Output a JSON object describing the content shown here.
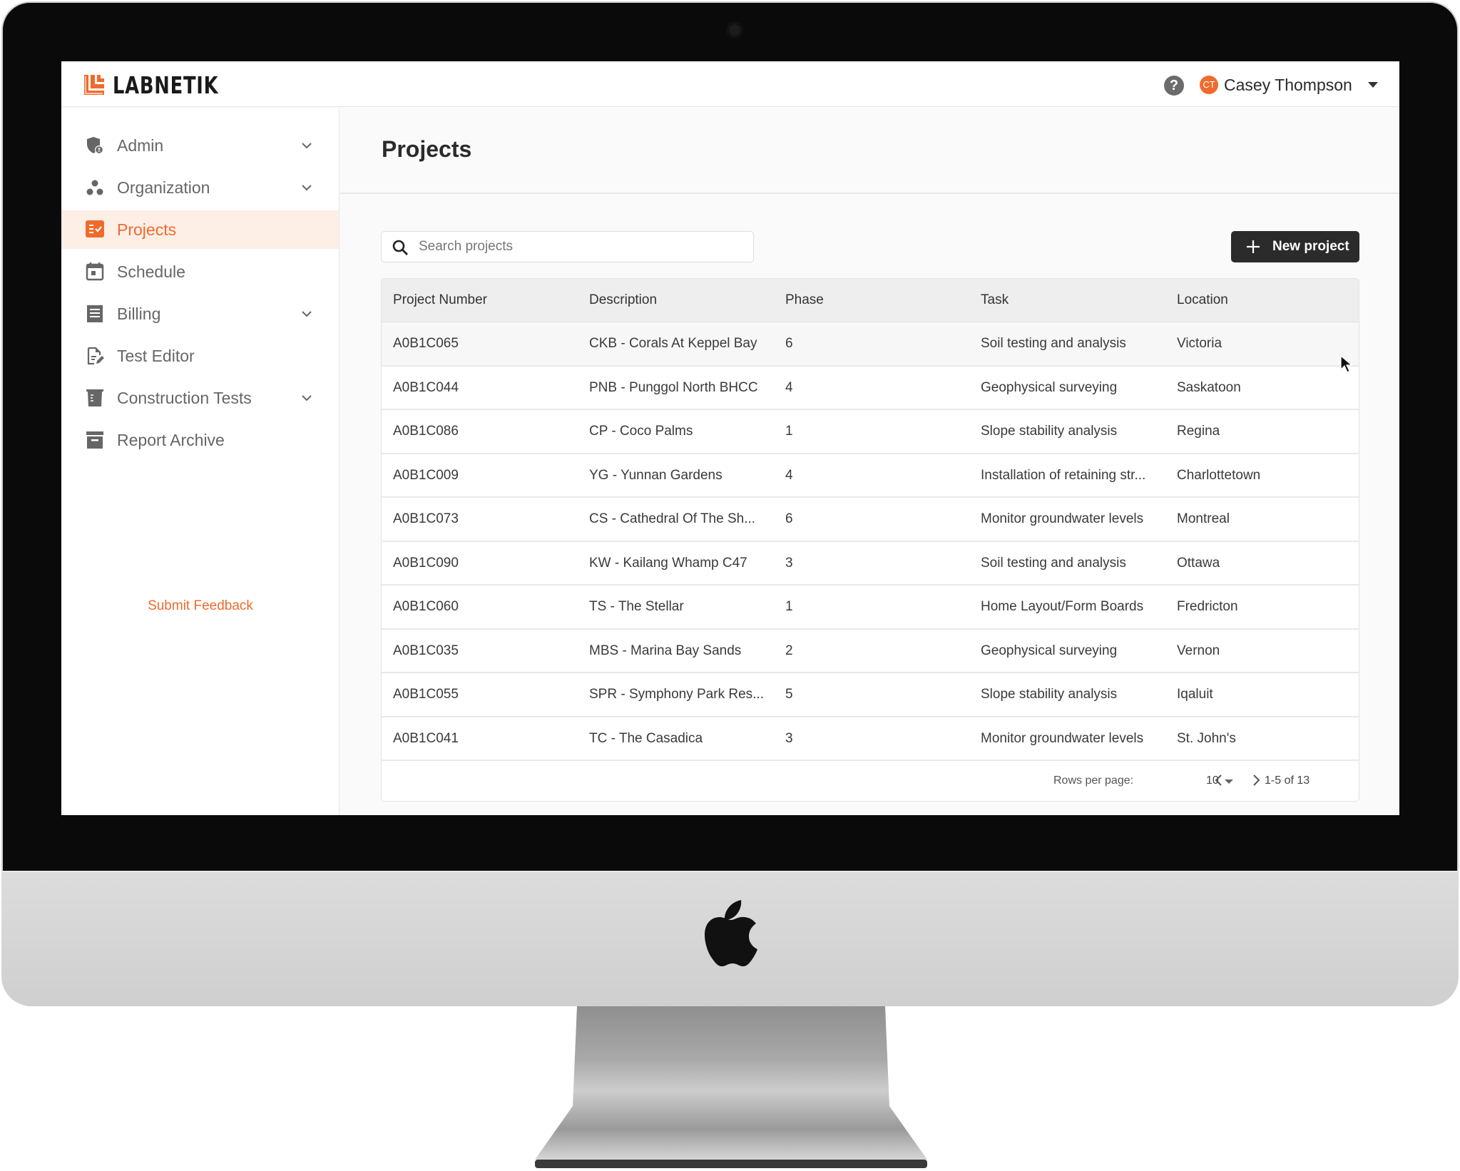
{
  "app": {
    "brand": "LABNETIK",
    "colors": {
      "accent": "#ef6b2d",
      "button_dark": "#2b2b2b",
      "active_bg": "#fdeee6"
    }
  },
  "header": {
    "help_icon": "question-circle-icon",
    "user": {
      "initials": "CT",
      "name": "Casey Thompson"
    }
  },
  "sidebar": {
    "items": [
      {
        "label": "Admin",
        "icon": "shield-user-icon",
        "expandable": true,
        "active": false
      },
      {
        "label": "Organization",
        "icon": "group-dots-icon",
        "expandable": true,
        "active": false
      },
      {
        "label": "Projects",
        "icon": "checklist-icon",
        "expandable": false,
        "active": true
      },
      {
        "label": "Schedule",
        "icon": "calendar-icon",
        "expandable": false,
        "active": false
      },
      {
        "label": "Billing",
        "icon": "receipt-icon",
        "expandable": true,
        "active": false
      },
      {
        "label": "Test Editor",
        "icon": "document-edit-icon",
        "expandable": false,
        "active": false
      },
      {
        "label": "Construction Tests",
        "icon": "beaker-icon",
        "expandable": true,
        "active": false
      },
      {
        "label": "Report Archive",
        "icon": "archive-box-icon",
        "expandable": false,
        "active": false
      }
    ],
    "feedback_label": "Submit Feedback"
  },
  "main": {
    "title": "Projects",
    "search": {
      "placeholder": "Search projects",
      "value": ""
    },
    "new_button_label": "New project",
    "table": {
      "columns": [
        "Project Number",
        "Description",
        "Phase",
        "Task",
        "Location"
      ],
      "rows": [
        [
          "A0B1C065",
          "CKB - Corals At Keppel Bay",
          "6",
          "Soil testing and analysis",
          "Victoria"
        ],
        [
          "A0B1C044",
          "PNB - Punggol North BHCC",
          "4",
          "Geophysical surveying",
          "Saskatoon"
        ],
        [
          "A0B1C086",
          "CP - Coco Palms",
          "1",
          "Slope stability analysis",
          "Regina"
        ],
        [
          "A0B1C009",
          "YG - Yunnan Gardens",
          "4",
          "Installation of retaining str...",
          "Charlottetown"
        ],
        [
          "A0B1C073",
          "CS - Cathedral Of The Sh...",
          "6",
          "Monitor groundwater levels",
          "Montreal"
        ],
        [
          "A0B1C090",
          "KW - Kailang Whamp C47",
          "3",
          "Soil testing and analysis",
          "Ottawa"
        ],
        [
          "A0B1C060",
          "TS - The Stellar",
          "1",
          "Home Layout/Form Boards",
          "Fredricton"
        ],
        [
          "A0B1C035",
          "MBS - Marina Bay Sands",
          "2",
          "Geophysical surveying",
          "Vernon"
        ],
        [
          "A0B1C055",
          "SPR - Symphony Park Res...",
          "5",
          "Slope stability analysis",
          "Iqaluit"
        ],
        [
          "A0B1C041",
          "TC - The Casadica",
          "3",
          "Monitor groundwater levels",
          "St. John's"
        ]
      ],
      "hovered_row": 0
    },
    "pagination": {
      "rows_per_page_label": "Rows per page:",
      "rows_per_page": "10",
      "range": "1-5 of 13"
    }
  }
}
